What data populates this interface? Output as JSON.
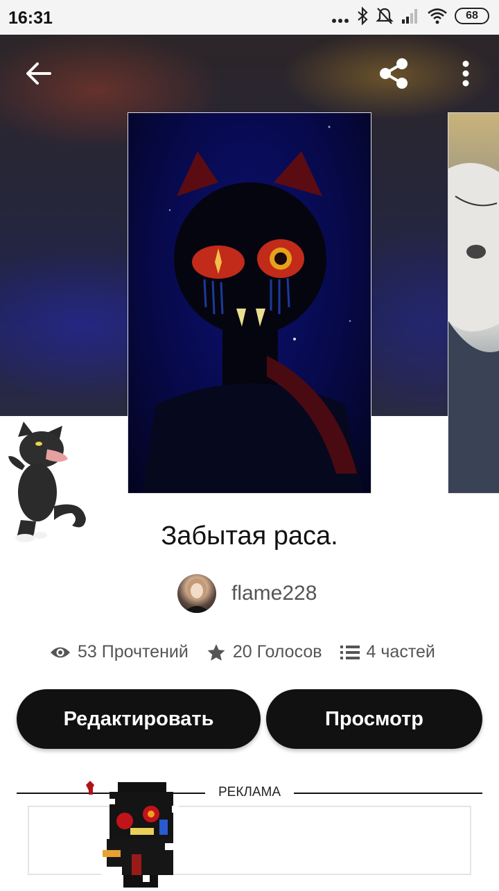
{
  "status_bar": {
    "time": "16:31",
    "battery": "68",
    "icons": [
      "dots-icon",
      "bluetooth-icon",
      "mute-icon",
      "signal-icon",
      "wifi-icon",
      "battery-icon"
    ]
  },
  "toolbar": {
    "back_icon": "arrow-left-icon",
    "share_icon": "share-icon",
    "more_icon": "more-vertical-icon"
  },
  "story": {
    "title": "Забытая раса.",
    "author": "flame228",
    "stats": {
      "reads": "53 Прочтений",
      "votes": "20 Голосов",
      "parts": "4 частей"
    }
  },
  "actions": {
    "edit_label": "Редактировать",
    "view_label": "Просмотр"
  },
  "ad": {
    "label": "РЕКЛАМА"
  },
  "colors": {
    "button_bg": "#111111",
    "button_text": "#ffffff",
    "stat_text": "#555555"
  }
}
